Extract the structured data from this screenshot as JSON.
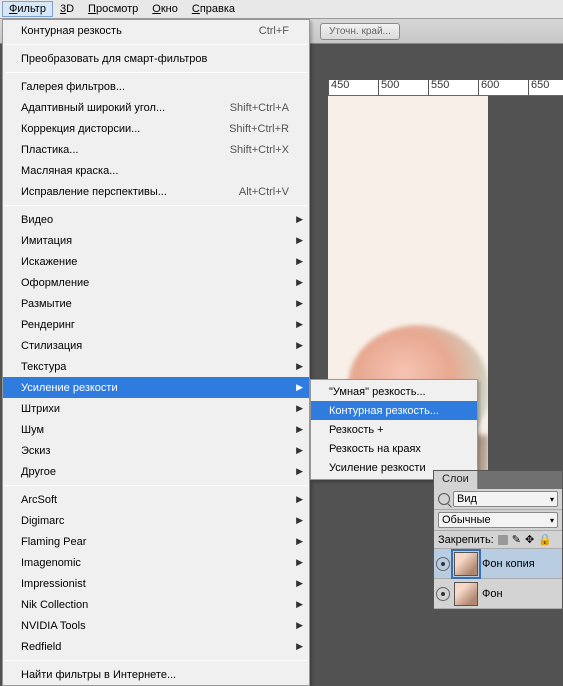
{
  "menubar": {
    "items": [
      {
        "label": "Фильтр",
        "mnemonic": "Ф",
        "active": true
      },
      {
        "label": "3D",
        "mnemonic": "3"
      },
      {
        "label": "Просмотр",
        "mnemonic": "П"
      },
      {
        "label": "Окно",
        "mnemonic": "О"
      },
      {
        "label": "Справка",
        "mnemonic": "С"
      }
    ]
  },
  "options_bar": {
    "refine_edge": "Уточн. край..."
  },
  "ruler": {
    "ticks": [
      "450",
      "500",
      "550",
      "600",
      "650"
    ]
  },
  "filter_menu": {
    "last_filter": {
      "label": "Контурная резкость",
      "shortcut": "Ctrl+F"
    },
    "convert_smart": "Преобразовать для смарт-фильтров",
    "group_top": [
      {
        "label": "Галерея фильтров..."
      },
      {
        "label": "Адаптивный широкий угол...",
        "shortcut": "Shift+Ctrl+A"
      },
      {
        "label": "Коррекция дисторсии...",
        "shortcut": "Shift+Ctrl+R"
      },
      {
        "label": "Пластика...",
        "shortcut": "Shift+Ctrl+X"
      },
      {
        "label": "Масляная краска..."
      },
      {
        "label": "Исправление перспективы...",
        "shortcut": "Alt+Ctrl+V"
      }
    ],
    "group_categories": [
      "Видео",
      "Имитация",
      "Искажение",
      "Оформление",
      "Размытие",
      "Рендеринг",
      "Стилизация",
      "Текстура",
      "Усиление резкости",
      "Штрихи",
      "Шум",
      "Эскиз",
      "Другое"
    ],
    "highlighted_category_index": 8,
    "group_plugins": [
      "ArcSoft",
      "Digimarc",
      "Flaming Pear",
      "Imagenomic",
      "Impressionist",
      "Nik Collection",
      "NVIDIA Tools",
      "Redfield"
    ],
    "browse": "Найти фильтры в Интернете..."
  },
  "sharpen_submenu": {
    "items": [
      "\"Умная\" резкость...",
      "Контурная резкость...",
      "Резкость +",
      "Резкость на краях",
      "Усиление резкости"
    ],
    "highlighted_index": 1
  },
  "layers_panel": {
    "tab": "Слои",
    "filter_kind": "Вид",
    "blend_mode": "Обычные",
    "lock_label": "Закрепить:",
    "layers": [
      {
        "name": "Фон копия",
        "visible": true,
        "selected": true
      },
      {
        "name": "Фон",
        "visible": true,
        "selected": false
      }
    ]
  }
}
